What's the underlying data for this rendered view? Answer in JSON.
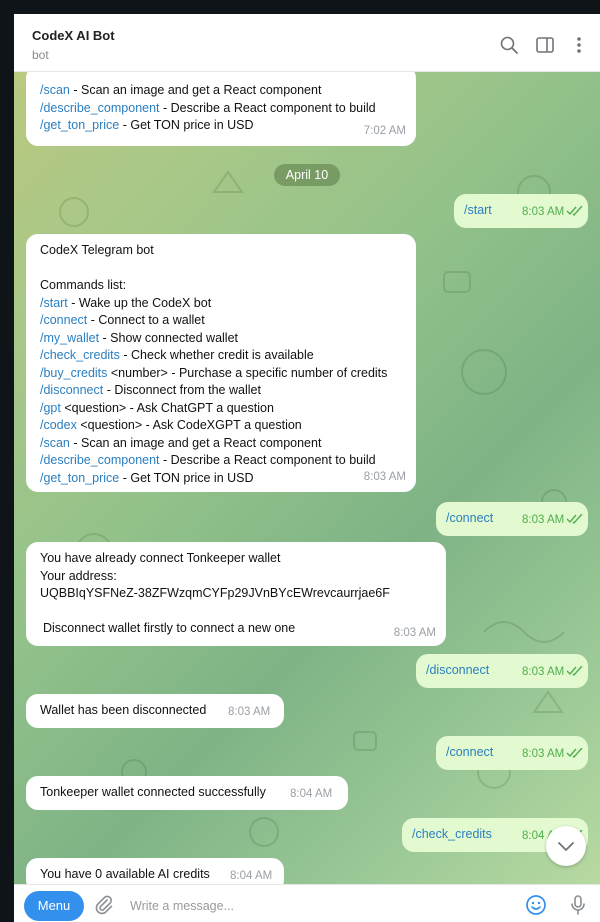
{
  "header": {
    "title": "CodeX AI Bot",
    "subtitle": "bot"
  },
  "chat": {
    "date_chip": "April 10",
    "top_partial": {
      "lines": [
        {
          "cmd": "/scan",
          "text": " - Scan an image and get a React component"
        },
        {
          "cmd": "/describe_component",
          "text": " - Describe a React component to build"
        },
        {
          "cmd": "/get_ton_price",
          "text": " - Get TON price in USD"
        }
      ],
      "time": "7:02 AM"
    },
    "out_start": {
      "text": "/start",
      "time": "8:03 AM"
    },
    "commands_msg": {
      "heading": "CodeX Telegram bot",
      "subheading": "Commands list:",
      "lines": [
        {
          "cmd": "/start",
          "text": " - Wake up the CodeX bot"
        },
        {
          "cmd": "/connect",
          "text": " - Connect to a wallet"
        },
        {
          "cmd": "/my_wallet",
          "text": " - Show connected wallet"
        },
        {
          "cmd": "/check_credits",
          "text": " - Check whether credit is available"
        },
        {
          "cmd": "/buy_credits",
          "text": " <number> - Purchase a specific number of credits"
        },
        {
          "cmd": "/disconnect",
          "text": " - Disconnect from the wallet"
        },
        {
          "cmd": "/gpt",
          "text": " <question> - Ask ChatGPT a question"
        },
        {
          "cmd": "/codex",
          "text": " <question> - Ask CodeXGPT a question"
        },
        {
          "cmd": "/scan",
          "text": " - Scan an image and get a React component"
        },
        {
          "cmd": "/describe_component",
          "text": " - Describe a React component to build"
        },
        {
          "cmd": "/get_ton_price",
          "text": " - Get TON price in USD"
        }
      ],
      "time": "8:03 AM"
    },
    "out_connect_1": {
      "text": "/connect",
      "time": "8:03 AM"
    },
    "wallet_msg": {
      "line1": "You have already connect Tonkeeper wallet",
      "line2": "Your address:",
      "line3": "UQBBIqYSFNeZ-38ZFWzqmCYFp29JVnBYcEWrevcaurrjae6F",
      "line4": "Disconnect wallet firstly to connect a new one",
      "time": "8:03 AM"
    },
    "out_disconnect": {
      "text": "/disconnect",
      "time": "8:03 AM"
    },
    "disconnected_msg": {
      "text": "Wallet has been disconnected",
      "time": "8:03 AM"
    },
    "out_connect_2": {
      "text": "/connect",
      "time": "8:03 AM"
    },
    "connected_msg": {
      "text": "Tonkeeper wallet connected successfully",
      "time": "8:04 AM"
    },
    "out_check_credits": {
      "text": "/check_credits",
      "time": "8:04 AM"
    },
    "credits_msg": {
      "text": "You have 0 available AI credits",
      "time": "8:04 AM"
    }
  },
  "composer": {
    "menu_label": "Menu",
    "placeholder": "Write a message..."
  },
  "colors": {
    "accent": "#3390ec",
    "link": "#2a7fc1",
    "outgoing_bubble": "#e3f9cf",
    "read_ticks": "#4fae4e"
  }
}
